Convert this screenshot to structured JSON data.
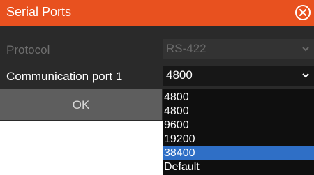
{
  "dialog": {
    "title": "Serial Ports",
    "close_icon": "close-circle-x-icon"
  },
  "protocol": {
    "label": "Protocol",
    "value": "RS-422",
    "enabled": false
  },
  "port": {
    "label": "Communication port 1",
    "value": "4800",
    "options": [
      "4800",
      "4800",
      "9600",
      "19200",
      "38400",
      "Default"
    ],
    "highlighted_option": "38400"
  },
  "buttons": {
    "ok": "OK"
  },
  "colors": {
    "accent": "#e8511f",
    "highlight": "#2f6fc6"
  }
}
